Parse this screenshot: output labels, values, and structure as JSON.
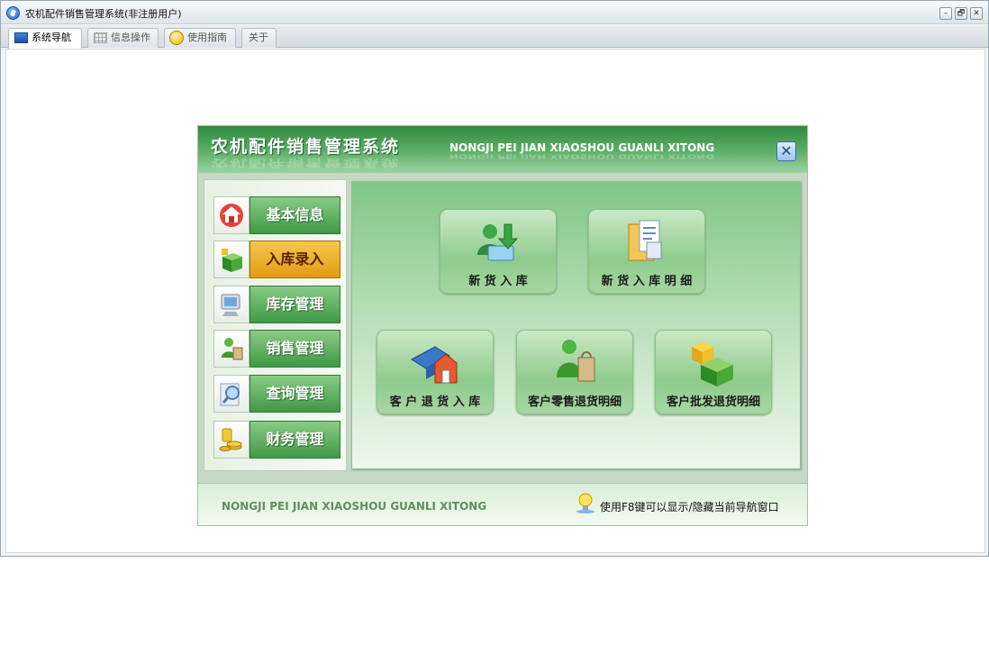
{
  "window": {
    "title": "农机配件销售管理系统(非注册用户)",
    "controls": {
      "minimize": "–",
      "restore": "🗗",
      "close": "✕"
    }
  },
  "tabs": [
    {
      "label": "系统导航",
      "icon": "monitor-icon",
      "active": true
    },
    {
      "label": "信息操作",
      "icon": "grid-icon",
      "active": false
    },
    {
      "label": "使用指南",
      "icon": "help-circle-icon",
      "active": false
    },
    {
      "label": "关于",
      "icon": "",
      "active": false
    }
  ],
  "nav_panel": {
    "title": "农机配件销售管理系统",
    "subtitle": "NONGJI PEI JIAN XIAOSHOU GUANLI XITONG",
    "close": "✕",
    "menu": [
      {
        "label": "基本信息",
        "icon": "house-icon",
        "active": false
      },
      {
        "label": "入库录入",
        "icon": "green-box-icon",
        "active": true
      },
      {
        "label": "库存管理",
        "icon": "monitor-icon",
        "active": false
      },
      {
        "label": "销售管理",
        "icon": "sales-person-icon",
        "active": false
      },
      {
        "label": "查询管理",
        "icon": "magnifier-icon",
        "active": false
      },
      {
        "label": "财务管理",
        "icon": "coins-icon",
        "active": false
      }
    ],
    "functions": [
      {
        "label": "新 货 入 库",
        "icon": "users-download-icon"
      },
      {
        "label": "新 货 入 库 明 细",
        "icon": "folder-document-icon"
      },
      {
        "label": "客 户 退 货 入 库",
        "icon": "house-book-icon"
      },
      {
        "label": "客户零售退货明细",
        "icon": "shopper-icon"
      },
      {
        "label": "客户批发退货明细",
        "icon": "cubes-icon"
      }
    ],
    "footer": {
      "text": "NONGJI PEI JIAN XIAOSHOU GUANLI XITONG",
      "hint": "使用F8键可以显示/隐藏当前导航窗口",
      "hint_icon": "lightbulb-icon"
    }
  }
}
